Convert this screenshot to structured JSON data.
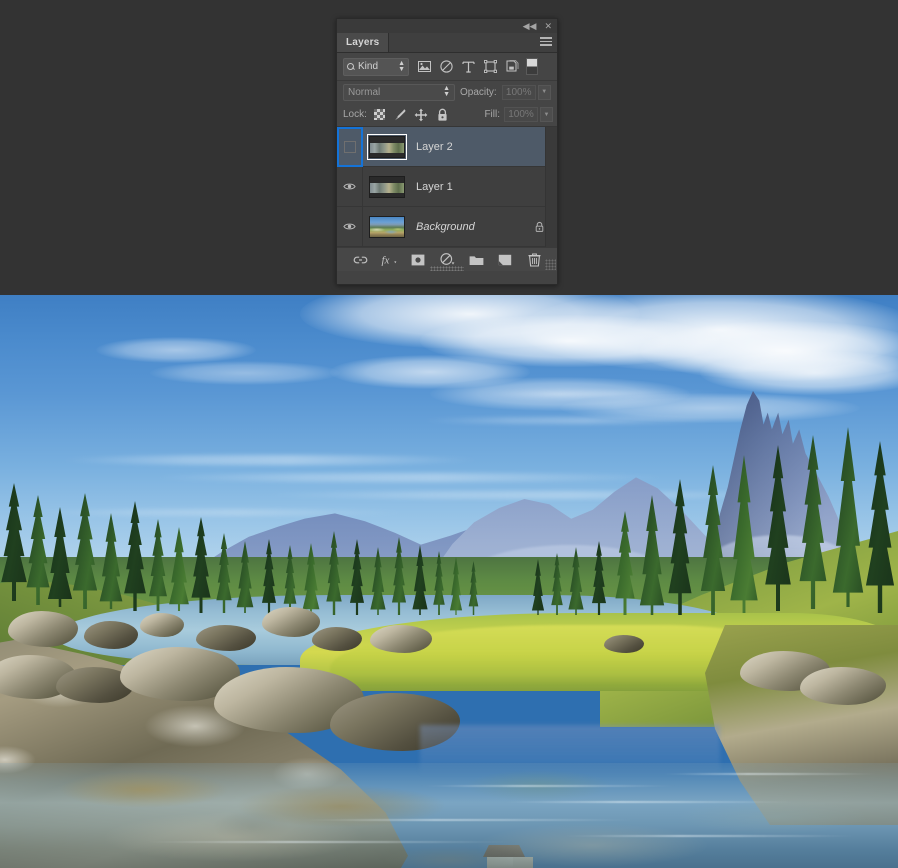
{
  "app": {
    "panel_title": "Layers"
  },
  "window_controls": {
    "collapse_icon": "collapse-to-icons",
    "collapse_glyph": "◀◀",
    "close_icon": "close",
    "close_glyph": "✕",
    "menu_icon": "panel-menu"
  },
  "filter_bar": {
    "kind_label": "Kind",
    "search_icon": "search-icon",
    "stepper_glyph": "⬍",
    "icons": [
      {
        "name": "filter-pixel-layers",
        "glyph": "image"
      },
      {
        "name": "filter-adjustment-layers",
        "glyph": "adjustment"
      },
      {
        "name": "filter-type-layers",
        "glyph": "T"
      },
      {
        "name": "filter-shape-layers",
        "glyph": "shape"
      },
      {
        "name": "filter-smart-objects",
        "glyph": "smart-object"
      }
    ],
    "toggle_name": "filter-enable-toggle"
  },
  "blend_bar": {
    "blend_mode": "Normal",
    "opacity_label": "Opacity:",
    "opacity_value": "100%"
  },
  "lock_bar": {
    "lock_label": "Lock:",
    "fill_label": "Fill:",
    "fill_value": "100%",
    "locks": [
      {
        "name": "lock-transparent-pixels",
        "glyph": "checker"
      },
      {
        "name": "lock-image-pixels",
        "glyph": "brush"
      },
      {
        "name": "lock-position",
        "glyph": "move"
      },
      {
        "name": "lock-all",
        "glyph": "lock"
      }
    ]
  },
  "layers": [
    {
      "name": "Layer 2",
      "visible": false,
      "selected": true,
      "locked": false,
      "italic": false,
      "thumb_type": "strip",
      "thumb_framed": true
    },
    {
      "name": "Layer 1",
      "visible": true,
      "selected": false,
      "locked": false,
      "italic": false,
      "thumb_type": "strip",
      "thumb_framed": false
    },
    {
      "name": "Background",
      "visible": true,
      "selected": false,
      "locked": true,
      "italic": true,
      "thumb_type": "photo",
      "thumb_framed": false
    }
  ],
  "bottom_bar": {
    "buttons": [
      {
        "name": "link-layers-button",
        "glyph": "link"
      },
      {
        "name": "layer-style-button",
        "glyph": "fx"
      },
      {
        "name": "add-layer-mask-button",
        "glyph": "mask"
      },
      {
        "name": "new-adjustment-layer-button",
        "glyph": "adjustment"
      },
      {
        "name": "new-group-button",
        "glyph": "folder"
      },
      {
        "name": "new-layer-button",
        "glyph": "new-layer"
      },
      {
        "name": "delete-layer-button",
        "glyph": "trash"
      }
    ]
  },
  "canvas": {
    "description": "Alpine lake landscape with Dolomites peaks, conifer forest, wooden cabin and rocky foreground shore",
    "colors": {
      "sky_top": "#3f7fc4",
      "sky_bottom": "#cfe3f1",
      "peak": "#8b9ec6",
      "forest": "#2d5527",
      "grass": "#d4d94f",
      "water": "#a8cbdc",
      "rock": "#bdb6a0",
      "backdrop": "#333333",
      "selection_blue": "#1473d8",
      "row_selected": "#4e5a68"
    }
  }
}
